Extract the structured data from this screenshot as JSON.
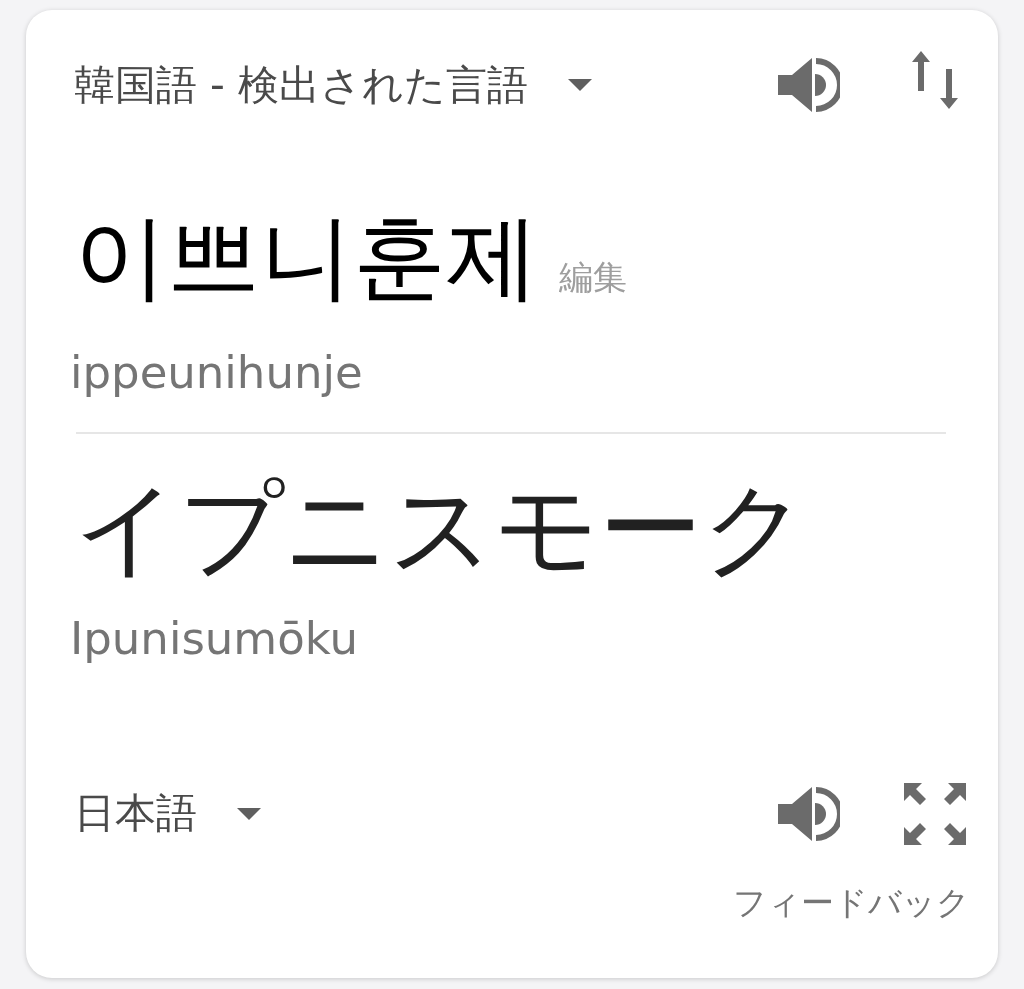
{
  "source": {
    "language": "韓国語 - 検出された言語",
    "text": "이쁘니훈제",
    "edit_label": "編集",
    "romanization": "ippeunihunje"
  },
  "target": {
    "language": "日本語",
    "text": "イプニスモーク",
    "romanization": "Ipunisumōku"
  },
  "feedback": "フィードバック"
}
